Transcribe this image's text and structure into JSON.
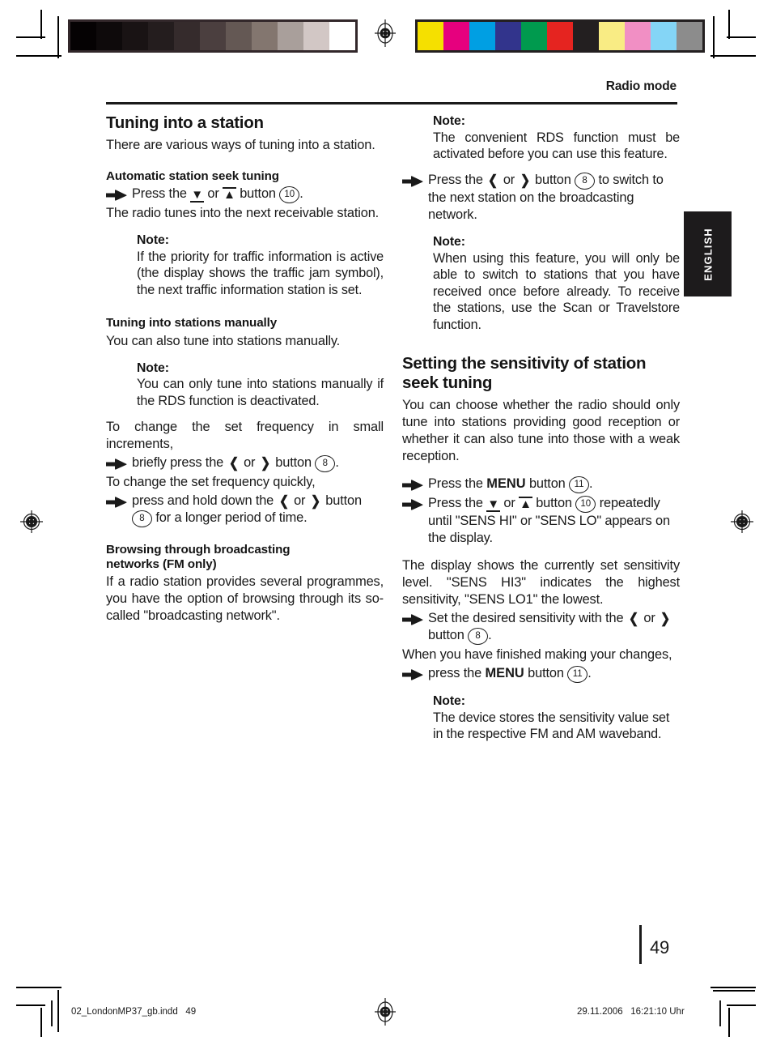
{
  "document": {
    "header_title": "Radio mode",
    "language_tab": "ENGLISH",
    "page_number": "49",
    "footer_file": "02_LondonMP37_gb.indd   49",
    "footer_timestamp": "29.11.2006   16:21:10 Uhr"
  },
  "calibration": {
    "gray_swatches": [
      "#050203",
      "#0e0a0b",
      "#191314",
      "#241d1e",
      "#352b2c",
      "#4b3f3f",
      "#645854",
      "#83766f",
      "#a99f9b",
      "#d2c7c5",
      "#ffffff"
    ],
    "color_swatches": [
      "#f5e000",
      "#e6007e",
      "#009fe3",
      "#32348c",
      "#009a4e",
      "#e52420",
      "#231f20",
      "#f9ec84",
      "#f18fc4",
      "#84d5f6",
      "#8c8c8c"
    ]
  },
  "left_column": {
    "heading": "Tuning into a station",
    "intro": "There are various ways of tuning into a station.",
    "sections": [
      {
        "subheading": "Automatic station seek tuning",
        "step_prefix": "Press the",
        "step_middle": "or",
        "step_button_word": "button",
        "step_button_num": "10",
        "step_suffix": ".",
        "after": "The radio tunes into the next receivable station.",
        "note_label": "Note:",
        "note_body": "If the priority for traffic information is active (the display shows the traffic jam symbol), the next traffic information station is set."
      },
      {
        "subheading": "Tuning into stations manually",
        "intro": "You can also tune into stations manually.",
        "note_label": "Note:",
        "note_body": "You can only tune into stations manually if the RDS function is deactivated.",
        "lead1": "To change the set frequency in small increments,",
        "step1_prefix": "briefly press the",
        "step1_middle": "or",
        "step1_button_word": "button",
        "step1_button_num": "8",
        "step1_suffix": ".",
        "lead2": "To change the set frequency quickly,",
        "step2_prefix": "press and hold down the",
        "step2_middle": "or",
        "step2_button_word": "button",
        "step2_button_num": "8",
        "step2_suffix": "for a longer period of time."
      },
      {
        "subheading_line1": "Browsing through broadcasting",
        "subheading_line2": "networks (FM only)",
        "body": "If a radio station provides several programmes, you have the option of browsing through its so-called \"broadcasting network\"."
      }
    ]
  },
  "right_column": {
    "note1_label": "Note:",
    "note1_body": "The convenient RDS function must be activated before you can use this feature.",
    "step1_prefix": "Press the",
    "step1_middle": "or",
    "step1_button_word": "button",
    "step1_button_num": "8",
    "step1_suffix": "to switch to the next station on the broadcasting network.",
    "note2_label": "Note:",
    "note2_body": "When using this feature, you will only be able to switch to stations that you have received once before already. To receive the stations, use the Scan or Travelstore function.",
    "heading_line1": "Setting the sensitivity of station",
    "heading_line2": "seek tuning",
    "body1": "You can choose whether the radio should only tune into stations providing good reception or whether it can also tune into those with a weak reception.",
    "step2_prefix": "Press the",
    "step2_kbd": "MENU",
    "step2_button_word": "button",
    "step2_button_num": "11",
    "step2_suffix": ".",
    "step3_prefix": "Press the",
    "step3_middle": "or",
    "step3_button_word": "button",
    "step3_button_num": "10",
    "step3_suffix": "repeatedly until \"SENS HI\" or \"SENS LO\" appears on the display.",
    "body2": "The display shows the currently set sensitivity level. \"SENS HI3\" indicates the highest sensitivity, \"SENS LO1\" the lowest.",
    "step4_prefix": "Set the desired sensitivity with the",
    "step4_middle": "or",
    "step4_button_word": "button",
    "step4_button_num": "8",
    "step4_suffix": ".",
    "body3": "When you have finished making your changes,",
    "step5_prefix": "press the",
    "step5_kbd": "MENU",
    "step5_button_word": "button",
    "step5_button_num": "11",
    "step5_suffix": ".",
    "note3_label": "Note:",
    "note3_body": "The device stores the sensitivity value set in the respective FM and AM waveband."
  }
}
